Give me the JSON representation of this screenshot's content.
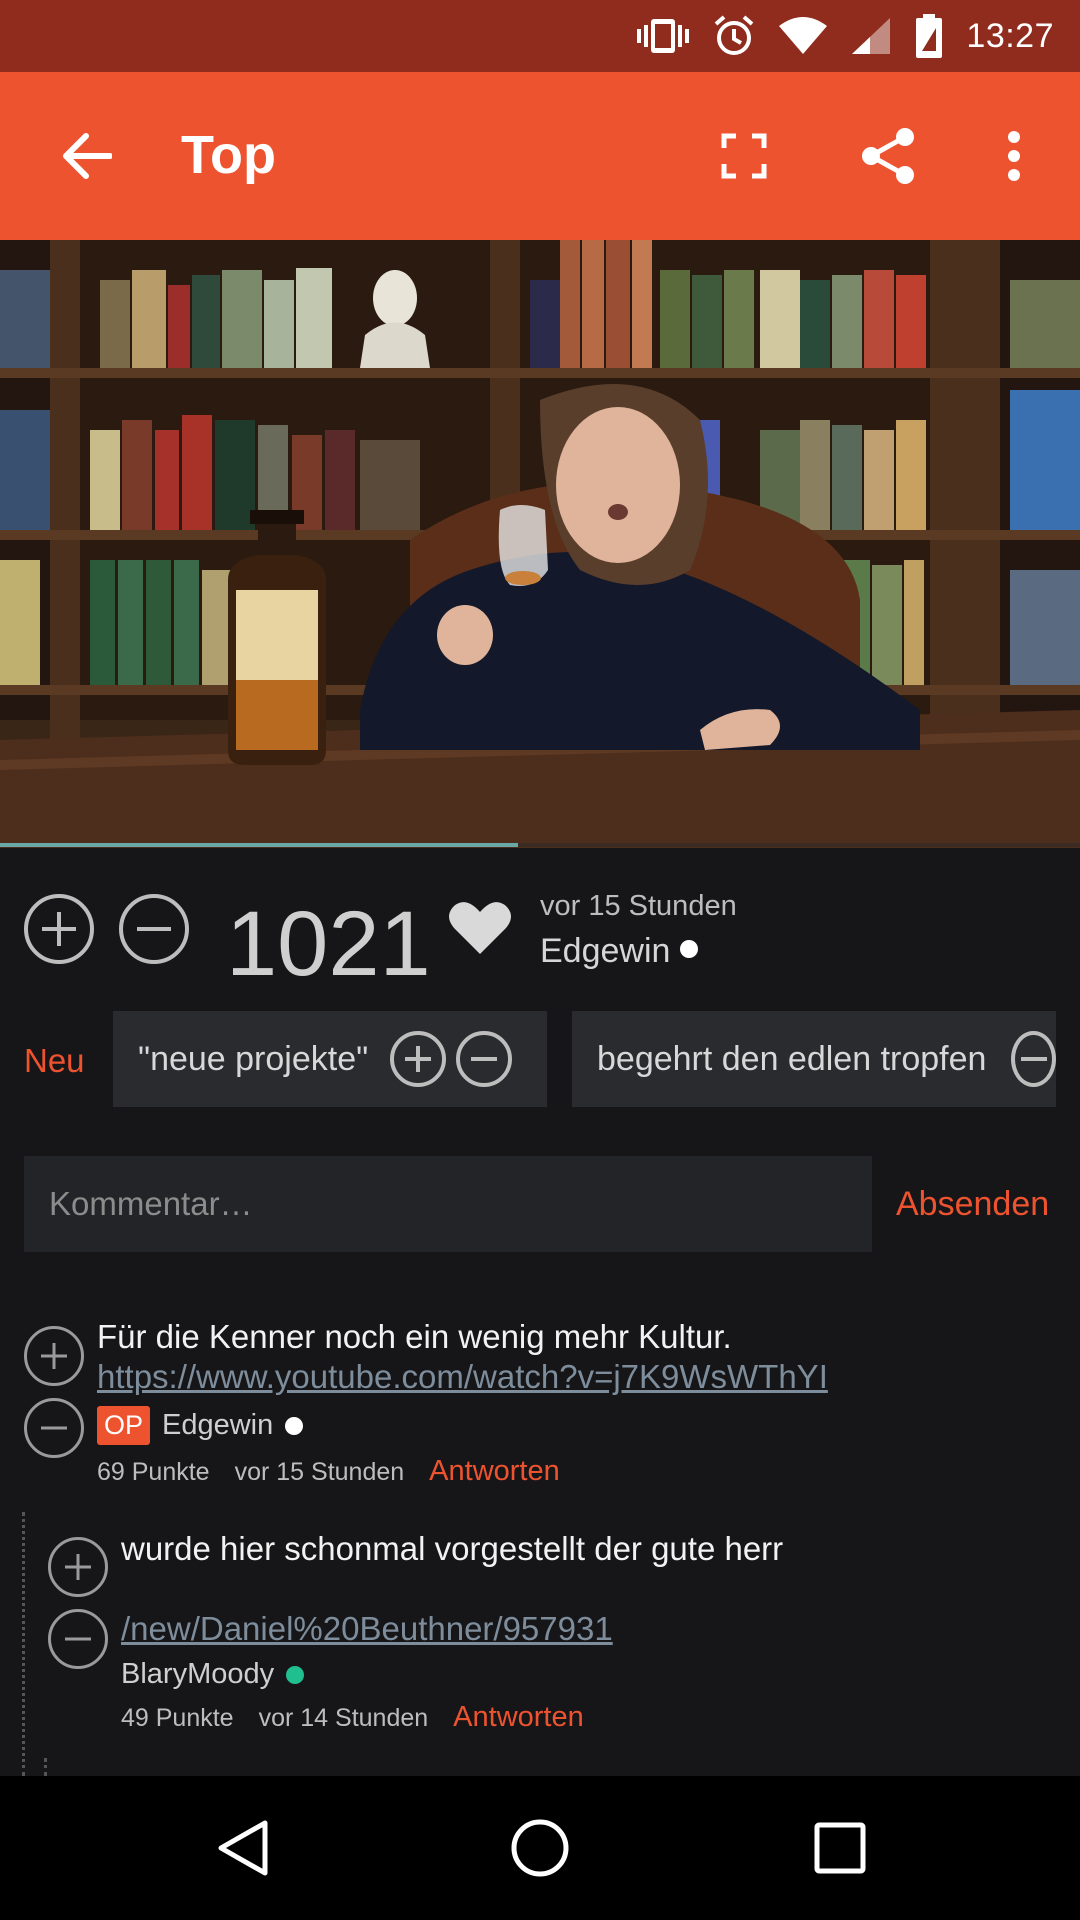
{
  "status_bar": {
    "time": "13:27",
    "icons": [
      "vibrate-icon",
      "alarm-icon",
      "wifi-icon",
      "signal-icon",
      "battery-icon"
    ]
  },
  "app_bar": {
    "title": "Top",
    "actions": [
      "back-arrow-icon",
      "fullscreen-icon",
      "share-icon",
      "more-vert-icon"
    ]
  },
  "media": {
    "progress": 0.48
  },
  "post": {
    "score": "1021",
    "time": "vor 15 Stunden",
    "user": "Edgewin"
  },
  "tags": {
    "new_label": "Neu",
    "items": [
      "\"neue projekte\"",
      "begehrt den edlen tropfen"
    ]
  },
  "comment_input": {
    "placeholder": "Kommentar…",
    "send_label": "Absenden"
  },
  "comments": [
    {
      "text": "Für die Kenner noch ein wenig mehr Kultur.",
      "link": "https://www.youtube.com/watch?v=j7K9WsWThYI",
      "badge": "OP",
      "user": "Edgewin",
      "points": "69 Punkte",
      "time": "vor 15 Stunden",
      "reply": "Antworten"
    },
    {
      "text": "wurde hier schonmal vorgestellt der gute herr",
      "link": "/new/Daniel%20Beuthner/957931",
      "user": "BlaryMoody",
      "points": "49 Punkte",
      "time": "vor 14 Stunden",
      "reply": "Antworten"
    }
  ],
  "colors": {
    "accent": "#ee5330",
    "status_bar": "#8f2c1d",
    "background": "#161618",
    "online_dot": "#1fbf8f"
  }
}
